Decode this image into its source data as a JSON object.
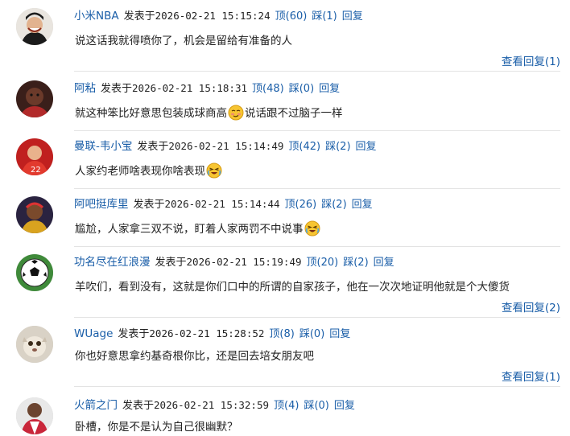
{
  "labels": {
    "posted_at": "发表于",
    "up": "顶",
    "down": "踩",
    "reply": "回复",
    "view_replies": "查看回复"
  },
  "comments": [
    {
      "username": "小米NBA",
      "timestamp": "2026-02-21 15:15:24",
      "up_count": "(60)",
      "down_count": "(1)",
      "text": "说这话我就得喷你了，机会是留给有准备的人",
      "reply_count": "(1)"
    },
    {
      "username": "阿粘",
      "timestamp": "2026-02-21 15:18:31",
      "up_count": "(48)",
      "down_count": "(0)",
      "text_before_emoji": "就这种笨比好意思包装成球商高",
      "text_after_emoji": "说话跟不过脑子一样",
      "emoji": "shy-smirk-emoji-icon"
    },
    {
      "username": "曼联-韦小宝",
      "timestamp": "2026-02-21 15:14:49",
      "up_count": "(42)",
      "down_count": "(2)",
      "text_before_emoji": "人家约老师啥表现你啥表现",
      "emoji": "crying-laugh-emoji-icon"
    },
    {
      "username": "阿吧挺库里",
      "timestamp": "2026-02-21 15:14:44",
      "up_count": "(26)",
      "down_count": "(2)",
      "text_before_emoji": "尴尬，人家拿三双不说，盯着人家两罚不中说事",
      "emoji": "crying-laugh-emoji-icon"
    },
    {
      "username": "功名尽在红浪漫",
      "timestamp": "2026-02-21 15:19:49",
      "up_count": "(20)",
      "down_count": "(2)",
      "text": "羊吹们，看到没有，这就是你们口中的所谓的自家孩子，他在一次次地证明他就是个大傻货",
      "reply_count": "(2)"
    },
    {
      "username": "WUage",
      "timestamp": "2026-02-21 15:28:52",
      "up_count": "(8)",
      "down_count": "(0)",
      "text": "你也好意思拿约基奇根你比，还是回去培女朋友吧",
      "reply_count": "(1)"
    },
    {
      "username": "火箭之门",
      "timestamp": "2026-02-21 15:32:59",
      "up_count": "(4)",
      "down_count": "(0)",
      "text": "卧槽，你是不是认为自己很幽默？"
    }
  ],
  "colors": {
    "link": "#1a5ea8",
    "text": "#222222",
    "divider": "#e3e3e3"
  }
}
